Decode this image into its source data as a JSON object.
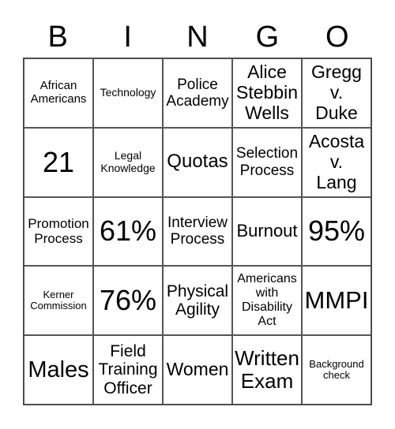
{
  "header": [
    "B",
    "I",
    "N",
    "G",
    "O"
  ],
  "cells": [
    "African\nAmericans",
    "Technology",
    "Police\nAcademy",
    "Alice\nStebbin\nWells",
    "Gregg\nv.\nDuke",
    "21",
    "Legal\nKnowledge",
    "Quotas",
    "Selection\nProcess",
    "Acosta\nv.\nLang",
    "Promotion\nProcess",
    "61%",
    "Interview\nProcess",
    "Burnout",
    "95%",
    "Kerner\nCommission",
    "76%",
    "Physical\nAgility",
    "Americans\nwith\nDisability\nAct",
    "MMPI",
    "Males",
    "Field\nTraining\nOfficer",
    "Women",
    "Written\nExam",
    "Background\ncheck"
  ]
}
